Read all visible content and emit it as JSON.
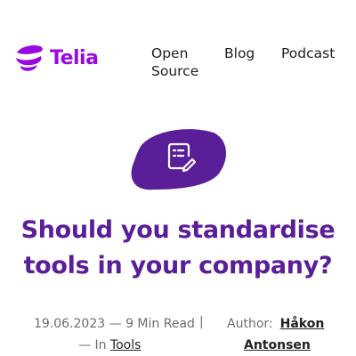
{
  "header": {
    "logo_text": "Telia",
    "nav": {
      "open_source": "Open Source",
      "open_source_line1": "Open",
      "open_source_line2": "Source",
      "blog": "Blog",
      "podcast": "Podcast"
    }
  },
  "hero": {
    "icon": "document-edit-icon"
  },
  "article": {
    "title": "Should you standardise tools in your company?",
    "date": "19.06.2023",
    "read_time": "9 Min Read",
    "separator": "|",
    "in_label": "In",
    "category": "Tools",
    "author_label": "Author:",
    "author_first": "Håkon",
    "author_last": "Antonsen"
  },
  "colors": {
    "brand": "#990ae3",
    "title": "#5b1e99",
    "muted": "#6e6e6e"
  }
}
